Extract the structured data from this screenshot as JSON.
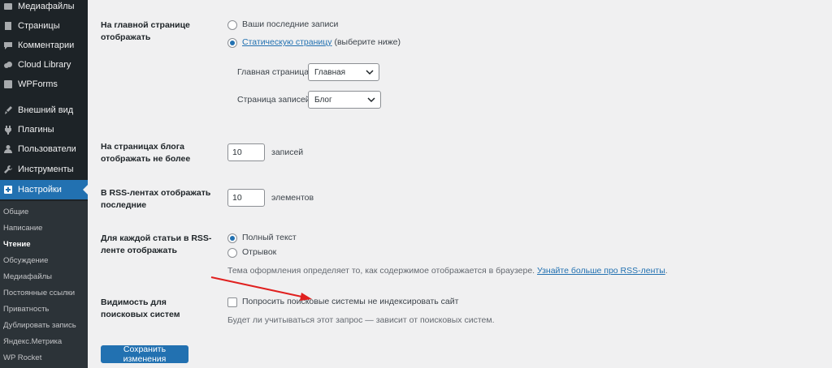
{
  "sidebar": {
    "items": [
      {
        "label": "Медиафайлы",
        "icon": "media-icon"
      },
      {
        "label": "Страницы",
        "icon": "pages-icon"
      },
      {
        "label": "Комментарии",
        "icon": "comments-icon"
      },
      {
        "label": "Cloud Library",
        "icon": "cloud-icon"
      },
      {
        "label": "WPForms",
        "icon": "forms-icon"
      },
      {
        "label": "Внешний вид",
        "icon": "brush-icon"
      },
      {
        "label": "Плагины",
        "icon": "plugin-icon"
      },
      {
        "label": "Пользователи",
        "icon": "users-icon"
      },
      {
        "label": "Инструменты",
        "icon": "wrench-icon"
      },
      {
        "label": "Настройки",
        "icon": "settings-icon"
      }
    ],
    "submenu": [
      "Общие",
      "Написание",
      "Чтение",
      "Обсуждение",
      "Медиафайлы",
      "Постоянные ссылки",
      "Приватность",
      "Дублировать запись",
      "Яндекс.Метрика",
      "WP Rocket"
    ],
    "active_item": "Настройки",
    "current_sub": "Чтение"
  },
  "front_page": {
    "label": "На главной странице отображать",
    "option_latest": "Ваши последние записи",
    "option_static_link": "Статическую страницу",
    "option_static_suffix": " (выберите ниже)",
    "homepage_label": "Главная страница:",
    "homepage_value": "Главная",
    "posts_page_label": "Страница записей:",
    "posts_page_value": "Блог"
  },
  "posts_per_page": {
    "label": "На страницах блога отображать не более",
    "value": "10",
    "unit": "записей"
  },
  "rss_count": {
    "label": "В RSS-лентах отображать последние",
    "value": "10",
    "unit": "элементов"
  },
  "rss_content": {
    "label": "Для каждой статьи в RSS-ленте отображать",
    "option_full": "Полный текст",
    "option_excerpt": "Отрывок",
    "note": "Тема оформления определяет то, как содержимое отображается в браузере.",
    "note_link": "Узнайте больше про RSS-ленты",
    "note_end": "."
  },
  "search_visibility": {
    "label": "Видимость для поисковых систем",
    "checkbox_label": "Попросить поисковые системы не индексировать сайт",
    "note": "Будет ли учитываться этот запрос — зависит от поисковых систем."
  },
  "save_button": "Сохранить изменения",
  "colors": {
    "sidebar_bg": "#1d2327",
    "accent": "#2271b1",
    "arrow": "#e0201f"
  }
}
